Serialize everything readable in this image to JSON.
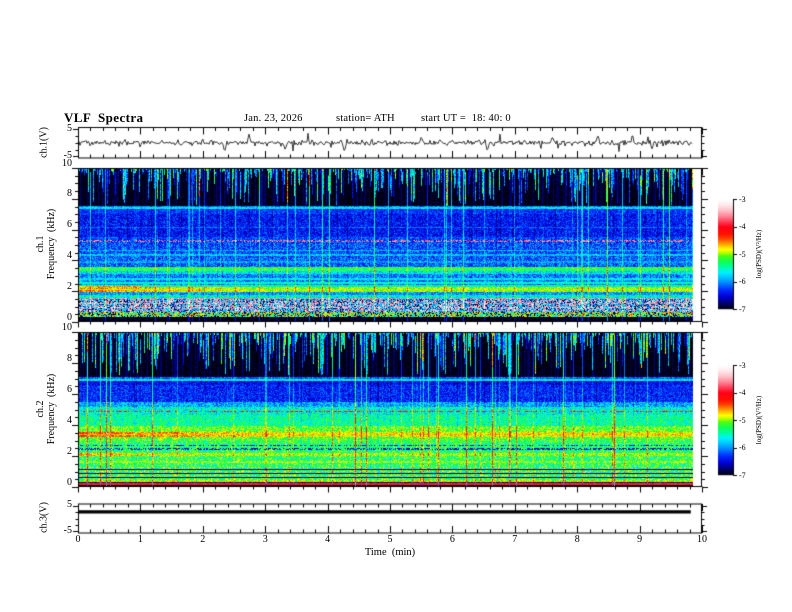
{
  "title": {
    "main": "VLF  Spectra",
    "date": "Jan. 23, 2026",
    "station": "station= ATH",
    "start_ut": "start UT =  18: 40: 0"
  },
  "x_axis": {
    "label": "Time  (min)",
    "min": 0,
    "max": 10,
    "minor_step": 0.2,
    "tick_values": [
      0,
      1,
      2,
      3,
      4,
      5,
      6,
      7,
      8,
      9,
      10
    ],
    "tick_labels": [
      "0",
      "1",
      "2",
      "3",
      "4",
      "5",
      "6",
      "7",
      "8",
      "9",
      "10"
    ]
  },
  "colorbar": {
    "label": "log(PSD)(V²/Hz)",
    "min": -7,
    "max": -3,
    "tick_values": [
      -3,
      -4,
      -5,
      -6,
      -7
    ],
    "tick_labels": [
      "-3",
      "-4",
      "-5",
      "-6",
      "-7"
    ],
    "colormap": [
      [
        -7.0,
        "#000000"
      ],
      [
        -6.8,
        "#000060"
      ],
      [
        -6.55,
        "#0000d0"
      ],
      [
        -6.3,
        "#0028ff"
      ],
      [
        -6.05,
        "#0080ff"
      ],
      [
        -5.85,
        "#00c0ff"
      ],
      [
        -5.65,
        "#00f0ff"
      ],
      [
        -5.45,
        "#00ffa0"
      ],
      [
        -5.25,
        "#10ff50"
      ],
      [
        -5.05,
        "#50ff10"
      ],
      [
        -4.95,
        "#b0ff00"
      ],
      [
        -4.82,
        "#ffff00"
      ],
      [
        -4.68,
        "#ffc000"
      ],
      [
        -4.55,
        "#ff8000"
      ],
      [
        -4.42,
        "#ff4000"
      ],
      [
        -4.25,
        "#ff1000"
      ],
      [
        -4.0,
        "#ff0018"
      ],
      [
        -3.8,
        "#ff4058"
      ],
      [
        -3.6,
        "#ff8898"
      ],
      [
        -3.4,
        "#ffc0c8"
      ],
      [
        -3.2,
        "#ffe8ec"
      ],
      [
        -3.0,
        "#ffffff"
      ]
    ]
  },
  "chart_data": [
    {
      "id": "ch1_waveform",
      "type": "line",
      "ylabel": "ch.1(V)",
      "ylim": [
        -5.8,
        5.8
      ],
      "ytick_values": [
        5,
        -5
      ],
      "ytick_labels": [
        "5",
        "-5"
      ],
      "baseline": 0,
      "noise_amp": 0.5,
      "spike_prob": 0.028,
      "spikes": [
        {
          "t": 2.35,
          "v": -3.1
        },
        {
          "t": 2.74,
          "v": 3.0
        },
        {
          "t": 3.32,
          "v": -2.6
        },
        {
          "t": 4.27,
          "v": -3.6
        },
        {
          "t": 5.5,
          "v": 2.2
        },
        {
          "t": 6.56,
          "v": -2.9
        },
        {
          "t": 7.6,
          "v": 2.0
        },
        {
          "t": 8.33,
          "v": 2.6
        },
        {
          "t": 9.2,
          "v": -2.2
        }
      ],
      "t_end": 9.85
    },
    {
      "id": "ch1_spectrogram",
      "type": "heatmap",
      "ylabel_lines": [
        "ch.1",
        "Frequency  (kHz)"
      ],
      "ylim": [
        0,
        10
      ],
      "ytick_values": [
        10,
        8,
        6,
        4,
        2,
        0
      ],
      "ytick_labels": [
        "10",
        "8",
        "6",
        "4",
        "2",
        "0"
      ],
      "zlim": [
        -7,
        -3
      ],
      "t_end": 9.85,
      "black_region": {
        "from": 7.55,
        "to": 9.93
      },
      "streaks": {
        "full_bright_prob": 0.01,
        "full_prob": 0.045,
        "col_var": 0.3,
        "dark_prob": 0.06,
        "max_depth": 2.45,
        "bright_min": 0.5,
        "bright_rng": 1.8,
        "blank_prob": 0.3
      },
      "bands": [
        {
          "f": [
            0,
            0.32
          ],
          "level": -6.95,
          "noise": 0.1
        },
        {
          "f": [
            0.32,
            0.62
          ],
          "mix": [
            [
              -4.7,
              0.35
            ],
            [
              -5.5,
              0.4
            ],
            [
              -6.9,
              0.25
            ]
          ],
          "noise": 0.3
        },
        {
          "f": [
            0.62,
            1.42
          ],
          "mix": [
            [
              -3.45,
              0.4
            ],
            [
              -5.9,
              0.45
            ],
            [
              -6.9,
              0.15
            ]
          ],
          "noise": 0.3
        },
        {
          "f": [
            1.42,
            1.52
          ],
          "level": -6.3,
          "noise": 0.3
        },
        {
          "f": [
            1.52,
            1.78
          ],
          "level": -5.6,
          "noise": 0.4
        },
        {
          "f": [
            1.78,
            1.95
          ],
          "level": -6.0,
          "noise": 0.3
        },
        {
          "f": [
            1.95,
            2.28
          ],
          "level": -5.0,
          "noise": 0.3,
          "boost": {
            "add": 0.4,
            "t_end": 3.3
          }
        },
        {
          "f": [
            2.28,
            2.42
          ],
          "level": -5.55,
          "noise": 0.3
        },
        {
          "f": [
            2.42,
            3.12
          ],
          "level": -6.05,
          "noise": 0.35
        },
        {
          "f": [
            3.12,
            3.3
          ],
          "level": -5.7,
          "noise": 0.35
        },
        {
          "f": [
            3.3,
            3.58
          ],
          "level": -5.3,
          "noise": 0.3
        },
        {
          "f": [
            3.58,
            4.2
          ],
          "level": -6.15,
          "noise": 0.35
        },
        {
          "f": [
            4.2,
            5.1
          ],
          "level": -6.2,
          "noise": 0.35
        },
        {
          "f": [
            5.1,
            5.55
          ],
          "level": -6.25,
          "noise": 0.3
        },
        {
          "f": [
            5.55,
            7.0
          ],
          "level": -6.4,
          "noise": 0.28
        },
        {
          "f": [
            7.0,
            7.38
          ],
          "level": -6.3,
          "noise": 0.25
        },
        {
          "f": [
            7.38,
            7.55
          ],
          "level": -6.05,
          "noise": 0.3
        },
        {
          "f": [
            7.55,
            9.93
          ],
          "level": -6.95,
          "noise": 0.08
        },
        {
          "f": [
            9.93,
            10
          ],
          "mix": [
            [
              -5.0,
              0.5
            ],
            [
              -6.0,
              0.3
            ],
            [
              -3.8,
              0.2
            ]
          ],
          "noise": 0.6
        }
      ],
      "lines": [
        {
          "f": 0.95,
          "l": -3.4,
          "w": 0.05,
          "n": 0.25,
          "dot": 0.45
        },
        {
          "f": 1.2,
          "l": -3.5,
          "w": 0.04,
          "n": 0.25,
          "dot": 0.5
        },
        {
          "f": 1.48,
          "l": -3.55,
          "w": 0.05,
          "n": 0.25,
          "dot": 0.5
        },
        {
          "f": 2.1,
          "l": -4.9,
          "w": 0.05,
          "n": 0.25
        },
        {
          "f": 2.28,
          "l": -4.65,
          "w": 0.07,
          "n": 0.3,
          "t_end": 1.0
        },
        {
          "f": 2.55,
          "l": -5.55,
          "w": 0.06,
          "n": 0.25
        },
        {
          "f": 2.8,
          "l": -5.7,
          "w": 0.05,
          "n": 0.25
        },
        {
          "f": 3.42,
          "l": -5.2,
          "w": 0.06,
          "n": 0.25
        },
        {
          "f": 3.9,
          "l": -5.95,
          "w": 0.04,
          "n": 0.25
        },
        {
          "f": 4.35,
          "l": -5.85,
          "w": 0.05,
          "n": 0.25
        },
        {
          "f": 4.62,
          "l": -5.9,
          "w": 0.04,
          "n": 0.25
        },
        {
          "f": 5.25,
          "l": -3.65,
          "w": 0.06,
          "n": 0.25,
          "dot": 0.5
        },
        {
          "f": 6.15,
          "l": -6.15,
          "w": 0.04,
          "n": 0.25
        },
        {
          "f": 7.42,
          "l": -5.7,
          "w": 0.08,
          "n": 0.3
        }
      ]
    },
    {
      "id": "ch2_spectrogram",
      "type": "heatmap",
      "ylabel_lines": [
        "ch.2",
        "Frequency  (kHz)"
      ],
      "ylim": [
        0,
        10
      ],
      "ytick_values": [
        10,
        8,
        6,
        4,
        2,
        0
      ],
      "ytick_labels": [
        "10",
        "8",
        "6",
        "4",
        "2",
        "0"
      ],
      "zlim": [
        -7,
        -3
      ],
      "t_end": 9.85,
      "black_region": {
        "from": 7.1,
        "to": 9.93
      },
      "streaks": {
        "full_bright_prob": 0.013,
        "full_prob": 0.07,
        "col_var": 0.3,
        "dark_prob": 0.05,
        "max_depth": 2.8,
        "bright_min": 0.6,
        "bright_rng": 1.9,
        "blank_prob": 0.25
      },
      "bands": [
        {
          "f": [
            0,
            0.13
          ],
          "level": -6.95,
          "noise": 0.08
        },
        {
          "f": [
            0.13,
            0.3
          ],
          "level": -6.55,
          "noise": 0.25
        },
        {
          "f": [
            0.3,
            0.46
          ],
          "level": -4.95,
          "noise": 0.35
        },
        {
          "f": [
            0.46,
            1.32
          ],
          "level": -5.2,
          "noise": 0.5
        },
        {
          "f": [
            1.32,
            2.0
          ],
          "level": -5.3,
          "noise": 0.45
        },
        {
          "f": [
            2.0,
            2.2
          ],
          "level": -4.95,
          "noise": 0.3,
          "boost": {
            "add": 0.25,
            "t_end": 2.5
          }
        },
        {
          "f": [
            2.2,
            2.95
          ],
          "level": -5.3,
          "noise": 0.4
        },
        {
          "f": [
            2.95,
            3.22
          ],
          "level": -5.15,
          "noise": 0.35
        },
        {
          "f": [
            3.22,
            3.58
          ],
          "level": -4.8,
          "noise": 0.25,
          "boost": {
            "add": 0.35,
            "t_end": 3.2
          }
        },
        {
          "f": [
            3.58,
            3.95
          ],
          "level": -5.1,
          "noise": 0.35
        },
        {
          "f": [
            3.95,
            4.62
          ],
          "level": -5.45,
          "noise": 0.4
        },
        {
          "f": [
            4.62,
            5.18
          ],
          "level": -5.6,
          "noise": 0.4
        },
        {
          "f": [
            5.18,
            5.5
          ],
          "level": -5.95,
          "noise": 0.35
        },
        {
          "f": [
            5.5,
            6.6
          ],
          "level": -6.35,
          "noise": 0.28
        },
        {
          "f": [
            6.6,
            6.85
          ],
          "level": -6.45,
          "noise": 0.25
        },
        {
          "f": [
            6.85,
            7.1
          ],
          "level": -6.15,
          "noise": 0.3
        },
        {
          "f": [
            7.1,
            9.93
          ],
          "level": -6.95,
          "noise": 0.08
        },
        {
          "f": [
            9.93,
            10
          ],
          "mix": [
            [
              -4.9,
              0.5
            ],
            [
              -5.8,
              0.3
            ],
            [
              -3.8,
              0.2
            ]
          ],
          "noise": 0.6
        }
      ],
      "lines": [
        {
          "f": 0.19,
          "l": -4.3,
          "w": 0.05,
          "n": 0.15
        },
        {
          "f": 0.62,
          "l": -6.8,
          "w": 0.05,
          "n": 0.15
        },
        {
          "f": 0.88,
          "l": -6.75,
          "w": 0.05,
          "n": 0.15
        },
        {
          "f": 1.12,
          "l": -6.75,
          "w": 0.04,
          "n": 0.15
        },
        {
          "f": 1.6,
          "l": -5.0,
          "w": 0.05,
          "n": 0.25
        },
        {
          "f": 2.45,
          "l": -6.55,
          "w": 0.05,
          "n": 0.2,
          "dot": 0.5
        },
        {
          "f": 2.7,
          "l": -6.5,
          "w": 0.04,
          "n": 0.2,
          "dot": 0.5
        },
        {
          "f": 3.4,
          "l": -4.7,
          "w": 0.05,
          "n": 0.25
        },
        {
          "f": 4.88,
          "l": -4.15,
          "w": 0.04,
          "n": 0.2,
          "dot": 0.55
        },
        {
          "f": 6.92,
          "l": -5.65,
          "w": 0.08,
          "n": 0.3
        }
      ]
    },
    {
      "id": "ch3_waveform",
      "type": "line",
      "ylabel": "ch.3(V)",
      "ylim": [
        -5.8,
        5.8
      ],
      "ytick_values": [
        5,
        -5
      ],
      "ytick_labels": [
        "5",
        "-5"
      ],
      "flat_value": 2.55,
      "line_width": 3.4,
      "t_end": 9.82
    }
  ]
}
